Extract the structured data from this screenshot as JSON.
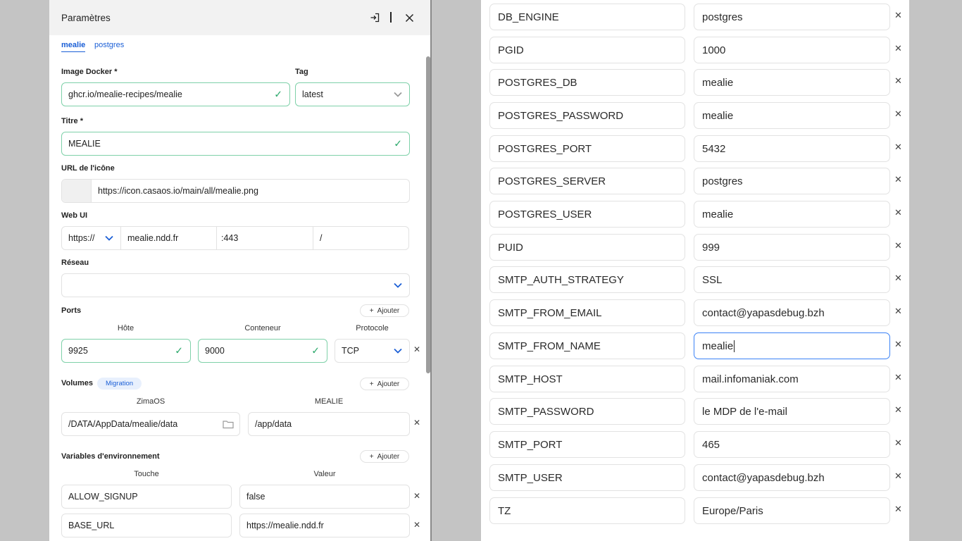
{
  "dialog": {
    "title": "Paramètres",
    "tabs": [
      "mealie",
      "postgres"
    ]
  },
  "form": {
    "image_label": "Image Docker *",
    "image_value": "ghcr.io/mealie-recipes/mealie",
    "tag_label": "Tag",
    "tag_value": "latest",
    "title_label": "Titre *",
    "title_value": "MEALIE",
    "icon_label": "URL de l'icône",
    "icon_value": "https://icon.casaos.io/main/all/mealie.png",
    "webui_label": "Web UI",
    "webui_scheme": "https://",
    "webui_host": "mealie.ndd.fr",
    "webui_port": ":443",
    "webui_path": "/",
    "network_label": "Réseau",
    "network_value": "",
    "ports_label": "Ports",
    "add_label": "Ajouter",
    "ports_cols": [
      "Hôte",
      "Conteneur",
      "Protocole"
    ],
    "port_host": "9925",
    "port_container": "9000",
    "port_protocol": "TCP",
    "volumes_label": "Volumes",
    "migration_badge": "Migration",
    "volumes_cols": [
      "ZimaOS",
      "MEALIE"
    ],
    "volume_host": "/DATA/AppData/mealie/data",
    "volume_container": "/app/data",
    "env_label": "Variables d'environnement",
    "env_cols": [
      "Touche",
      "Valeur"
    ],
    "env_rows": [
      {
        "key": "ALLOW_SIGNUP",
        "value": "false"
      },
      {
        "key": "BASE_URL",
        "value": "https://mealie.ndd.fr"
      }
    ]
  },
  "env_right": [
    {
      "key": "DB_ENGINE",
      "value": "postgres"
    },
    {
      "key": "PGID",
      "value": "1000"
    },
    {
      "key": "POSTGRES_DB",
      "value": "mealie"
    },
    {
      "key": "POSTGRES_PASSWORD",
      "value": "mealie"
    },
    {
      "key": "POSTGRES_PORT",
      "value": "5432"
    },
    {
      "key": "POSTGRES_SERVER",
      "value": "postgres"
    },
    {
      "key": "POSTGRES_USER",
      "value": "mealie"
    },
    {
      "key": "PUID",
      "value": "999"
    },
    {
      "key": "SMTP_AUTH_STRATEGY",
      "value": "SSL"
    },
    {
      "key": "SMTP_FROM_EMAIL",
      "value": "contact@yapasdebug.bzh"
    },
    {
      "key": "SMTP_FROM_NAME",
      "value": "mealie"
    },
    {
      "key": "SMTP_HOST",
      "value": "mail.infomaniak.com"
    },
    {
      "key": "SMTP_PASSWORD",
      "value": "le MDP de l'e-mail"
    },
    {
      "key": "SMTP_PORT",
      "value": "465"
    },
    {
      "key": "SMTP_USER",
      "value": "contact@yapasdebug.bzh"
    },
    {
      "key": "TZ",
      "value": "Europe/Paris"
    }
  ],
  "colors": {
    "accent": "#1b5fd6",
    "valid_border": "#7fd1a9",
    "check": "#2faa6e",
    "focus": "#3b82f6"
  },
  "icons": [
    "export-icon",
    "close-icon",
    "check-icon",
    "chevron-down-icon",
    "plus-icon",
    "folder-icon",
    "remove-icon"
  ]
}
